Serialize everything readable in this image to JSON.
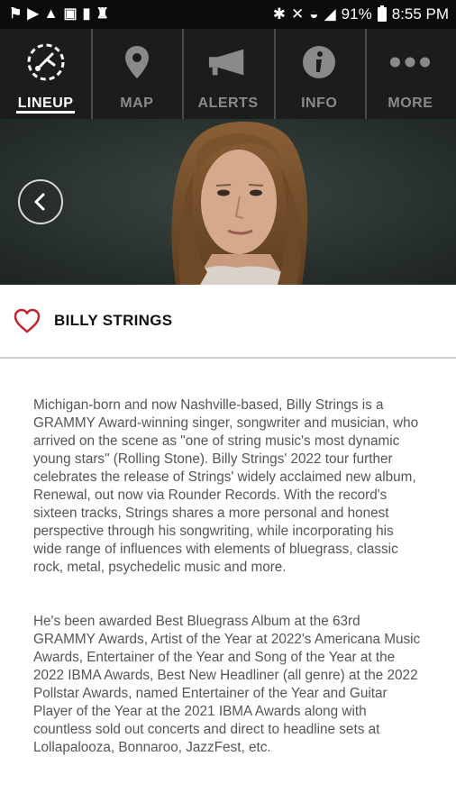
{
  "status_bar": {
    "left_icons": [
      "notification-icon",
      "play-icon",
      "warning-icon",
      "calendar-icon",
      "notification-icon",
      "alert-icon"
    ],
    "battery": "91%",
    "time": "8:55 PM"
  },
  "nav": {
    "tabs": [
      {
        "label": "LINEUP",
        "icon": "lineup-icon",
        "active": true
      },
      {
        "label": "MAP",
        "icon": "map-pin-icon",
        "active": false
      },
      {
        "label": "ALERTS",
        "icon": "megaphone-icon",
        "active": false
      },
      {
        "label": "INFO",
        "icon": "info-icon",
        "active": false
      },
      {
        "label": "MORE",
        "icon": "more-icon",
        "active": false
      }
    ]
  },
  "artist": {
    "name": "BILLY STRINGS",
    "favorite_icon": "heart-icon",
    "bio": [
      "Michigan-born and now Nashville-based, Billy Strings is a GRAMMY Award-winning singer, songwriter and musician, who arrived on the scene as \"one of string music's most dynamic young stars\" (Rolling Stone). Billy Strings' 2022 tour further celebrates the release of Strings' widely acclaimed new album, Renewal, out now via Rounder Records. With the record's sixteen tracks, Strings shares a more personal and honest perspective through his songwriting, while incorporating his wide range of influences with elements of bluegrass, classic rock, metal, psychedelic music and more.",
      "He's been awarded Best Bluegrass Album at the 63rd GRAMMY Awards, Artist of the Year at 2022's Americana Music Awards, Entertainer of the Year and Song of the Year at the 2022 IBMA Awards, Best New Headliner (all genre) at the 2022 Pollstar Awards, named Entertainer of the Year and Guitar Player of the Year at the 2021 IBMA Awards along with countless sold out concerts and direct to headline sets at Lollapalooza, Bonnaroo, JazzFest, etc."
    ]
  },
  "colors": {
    "nav_bg": "#1c1c1c",
    "nav_active": "#ffffff",
    "nav_inactive": "#8a8a8a",
    "heart": "#c0272d",
    "body_text": "#555555"
  }
}
